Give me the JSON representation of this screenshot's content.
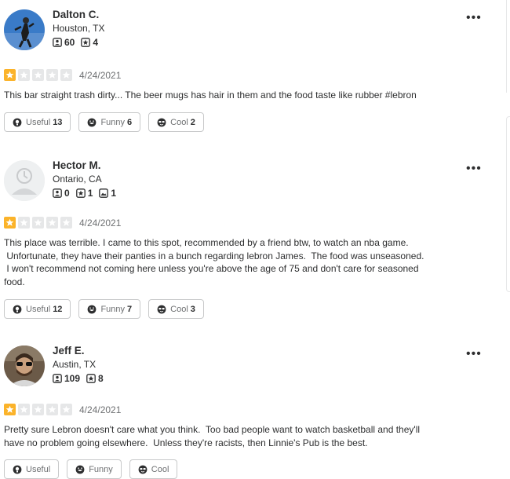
{
  "colors": {
    "star_fill": "#fbb32a",
    "star_empty": "#e6e7e8",
    "text": "#2d2e2f",
    "muted": "#6e7072"
  },
  "reviews": [
    {
      "name": "Dalton C.",
      "location": "Houston, TX",
      "stats": [
        {
          "icon": "friends-icon",
          "value": "60"
        },
        {
          "icon": "reviews-icon",
          "value": "4"
        }
      ],
      "rating": 1,
      "date": "4/24/2021",
      "text": [
        "This bar straight trash dirty... The beer mugs has hair in them and the food taste like rubber #lebron"
      ],
      "buttons": {
        "useful_label": "Useful",
        "useful_count": "13",
        "funny_label": "Funny",
        "funny_count": "6",
        "cool_label": "Cool",
        "cool_count": "2"
      }
    },
    {
      "name": "Hector M.",
      "location": "Ontario, CA",
      "stats": [
        {
          "icon": "friends-icon",
          "value": "0"
        },
        {
          "icon": "reviews-icon",
          "value": "1"
        },
        {
          "icon": "photos-icon",
          "value": "1"
        }
      ],
      "rating": 1,
      "date": "4/24/2021",
      "text": [
        "This place was terrible. I came to this spot, recommended by a friend btw, to watch an nba game.",
        " Unfortunate, they have their panties in a bunch regarding lebron James.  The food was unseasoned.",
        " I won't recommend not coming here unless you're above the age of 75 and don't care for seasoned",
        "food."
      ],
      "buttons": {
        "useful_label": "Useful",
        "useful_count": "12",
        "funny_label": "Funny",
        "funny_count": "7",
        "cool_label": "Cool",
        "cool_count": "3"
      }
    },
    {
      "name": "Jeff E.",
      "location": "Austin, TX",
      "stats": [
        {
          "icon": "friends-icon",
          "value": "109"
        },
        {
          "icon": "reviews-icon",
          "value": "8"
        }
      ],
      "rating": 1,
      "date": "4/24/2021",
      "text": [
        "Pretty sure Lebron doesn't care what you think.  Too bad people want to watch basketball and they'll",
        "have no problem going elsewhere.  Unless they're racists, then Linnie's Pub is the best."
      ],
      "buttons": {
        "useful_label": "Useful",
        "useful_count": "",
        "funny_label": "Funny",
        "funny_count": "",
        "cool_label": "Cool",
        "cool_count": ""
      }
    }
  ]
}
